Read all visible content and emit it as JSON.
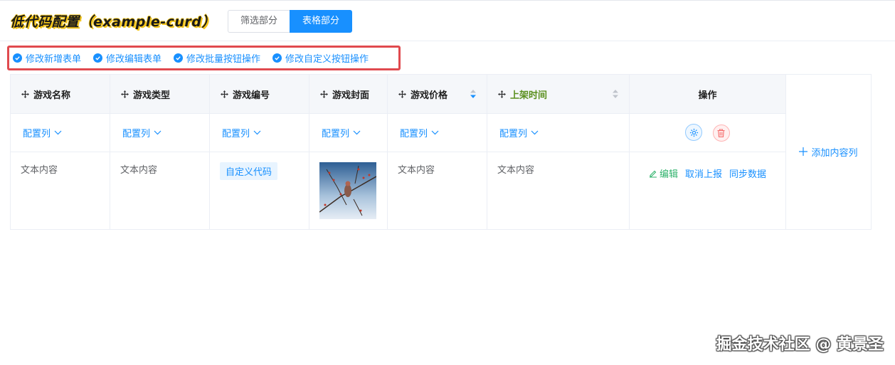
{
  "header": {
    "title": "低代码配置（example-curd）",
    "tabs": [
      {
        "label": "筛选部分",
        "active": false
      },
      {
        "label": "表格部分",
        "active": true
      }
    ]
  },
  "edit_links": [
    "修改新增表单",
    "修改编辑表单",
    "修改批量按钮操作",
    "修改自定义按钮操作"
  ],
  "table": {
    "columns": [
      "游戏名称",
      "游戏类型",
      "游戏编号",
      "游戏封面",
      "游戏价格",
      "上架时间",
      "操作"
    ],
    "config_label": "配置列",
    "row": {
      "name": "文本内容",
      "type": "文本内容",
      "code": "自定义代码",
      "price": "文本内容",
      "time": "文本内容"
    },
    "actions": [
      "编辑",
      "取消上报",
      "同步数据"
    ],
    "add_column": "添加内容列"
  },
  "colors": {
    "accent": "#1890ff",
    "highlight_box": "#e04a4f",
    "time_header": "#5a8f1e",
    "edit_action": "#2fb26b"
  },
  "watermark": "掘金技术社区 @ 黄景圣"
}
